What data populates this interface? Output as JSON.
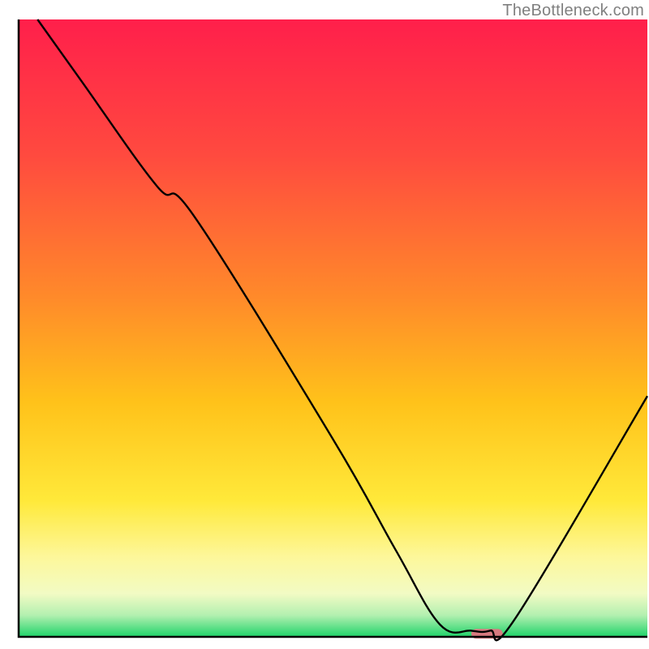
{
  "watermark": "TheBottleneck.com",
  "chart_data": {
    "type": "line",
    "title": "",
    "xlabel": "",
    "ylabel": "",
    "xlim": [
      0,
      100
    ],
    "ylim": [
      0,
      100
    ],
    "grid": false,
    "series": [
      {
        "name": "bottleneck-curve",
        "x": [
          3,
          10,
          22,
          28,
          50,
          60,
          67,
          72,
          75,
          79,
          100
        ],
        "values": [
          100,
          90,
          73,
          68,
          32,
          14,
          2,
          1,
          1,
          3,
          39
        ]
      }
    ],
    "marker": {
      "name": "optimal-zone",
      "x_start": 72,
      "x_end": 77,
      "y": 0.5,
      "color": "#d77a7f"
    },
    "gradient_stops": [
      {
        "offset": 0.0,
        "color": "#ff1f4b"
      },
      {
        "offset": 0.22,
        "color": "#ff4a3f"
      },
      {
        "offset": 0.45,
        "color": "#ff8a2a"
      },
      {
        "offset": 0.62,
        "color": "#ffc21a"
      },
      {
        "offset": 0.78,
        "color": "#ffe93a"
      },
      {
        "offset": 0.87,
        "color": "#fdf79a"
      },
      {
        "offset": 0.93,
        "color": "#f2fbc4"
      },
      {
        "offset": 0.965,
        "color": "#b3f0b0"
      },
      {
        "offset": 1.0,
        "color": "#1fd36a"
      }
    ],
    "axis_color": "#000000",
    "line_color": "#000000",
    "line_width": 2.4
  }
}
